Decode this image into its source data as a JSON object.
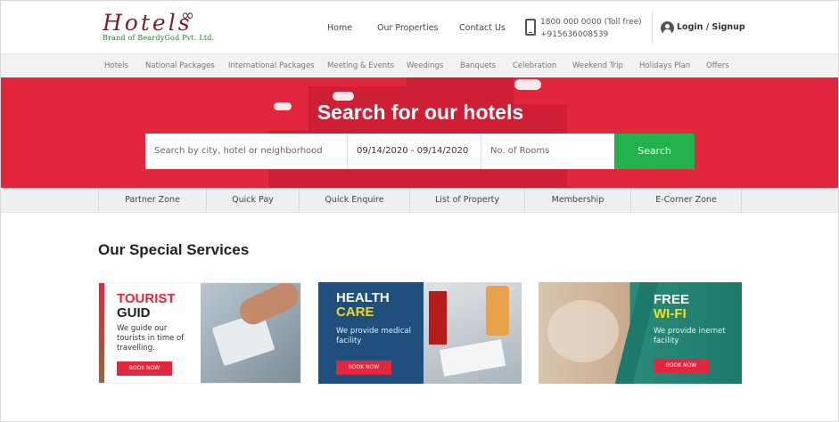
{
  "header": {
    "logo_word": "Hotels",
    "logo_symbol": "∞",
    "logo_tagline": "Brand of BeardyGod Pvt. Ltd.",
    "nav": [
      "Home",
      "Our Properties",
      "Contact Us"
    ],
    "phone_line1": "1800 000 0000 (Toll free)",
    "phone_line2": "+915636008539",
    "login_label": "Login / Signup"
  },
  "categories": [
    "Hotels",
    "National Packages",
    "International Packages",
    "Meeting & Events",
    "Weedings",
    "Banquets",
    "Celebration",
    "Weekend Trip",
    "Holidays Plan",
    "Offers"
  ],
  "hero": {
    "title": "Search for our hotels",
    "search_placeholder": "Search by city, hotel or neighborhood",
    "date_value": "09/14/2020 - 09/14/2020",
    "rooms_placeholder": "No. of Rooms",
    "search_button": "Search"
  },
  "quick_links": [
    "Partner Zone",
    "Quick Pay",
    "Quick Enquire",
    "List of Property",
    "Membership",
    "E-Corner Zone"
  ],
  "services": {
    "title": "Our Special Services",
    "cards": [
      {
        "line1": "TOURIST",
        "line2": "GUID",
        "desc": "We guide our tourists in time of travelling.",
        "button": "BOOK NOW"
      },
      {
        "line1": "HEALTH",
        "line2": "CARE",
        "desc": "We provide medical facility",
        "button": "BOOK NOW"
      },
      {
        "line1": "FREE",
        "line2": "WI-FI",
        "desc": "We provide inernet facility",
        "button": "BOOK NOW"
      }
    ]
  },
  "colors": {
    "brand_red": "#e2273d",
    "search_green": "#21b24b",
    "logo_maroon": "#7b1f2a",
    "health_yellow": "#f3d51c",
    "wifi_yellow": "#f0e21a"
  }
}
